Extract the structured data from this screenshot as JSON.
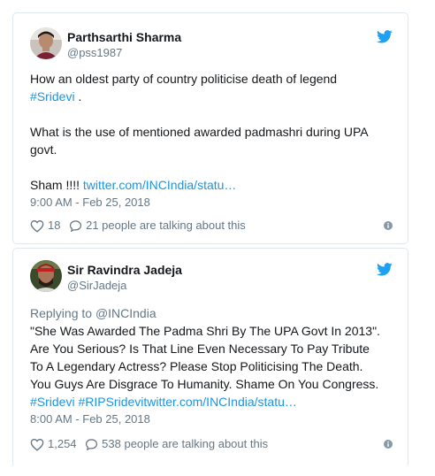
{
  "tweets": [
    {
      "display_name": "Parthsarthi Sharma",
      "handle": "@pss1987",
      "line1": "How an oldest party of country politicise death of legend",
      "hashtag": "#Sridevi",
      "hashtag_suffix": " .",
      "line2a": "What is the use of mentioned awarded padmashri during UPA",
      "line2b": "govt.",
      "sham_text": "Sham !!!! ",
      "sham_link": "twitter.com/INCIndia/statu…",
      "timestamp": "9:00 AM - Feb 25, 2018",
      "likes": "18",
      "talking": "21 people are talking about this",
      "avatar_icon": "profile-photo",
      "brand_icon": "twitter-bird-icon"
    },
    {
      "display_name": "Sir Ravindra Jadeja",
      "handle": "@SirJadeja",
      "replying_prefix": "Replying to ",
      "replying_handle": "@INCIndia",
      "text_lines": [
        "\"She Was Awarded The Padma Shri By The UPA Govt In 2013\".",
        "Are You Serious? Is That Line Even Necessary To Pay Tribute",
        "To A Legendary Actress? Please Stop Politicising The Death.",
        "You Guys Are Disgrace To Humanity. Shame On You Congress."
      ],
      "tags_line": "#Sridevi #RIPSridevitwitter.com/INCIndia/statu…",
      "timestamp": "8:00 AM - Feb 25, 2018",
      "likes": "1,254",
      "talking": "538 people are talking about this",
      "avatar_icon": "profile-photo",
      "brand_icon": "twitter-bird-icon"
    }
  ],
  "colors": {
    "link": "#1b95e0",
    "muted": "#657786",
    "text": "#14171a",
    "border": "#e1e8ed",
    "bird": "#1da1f2"
  }
}
